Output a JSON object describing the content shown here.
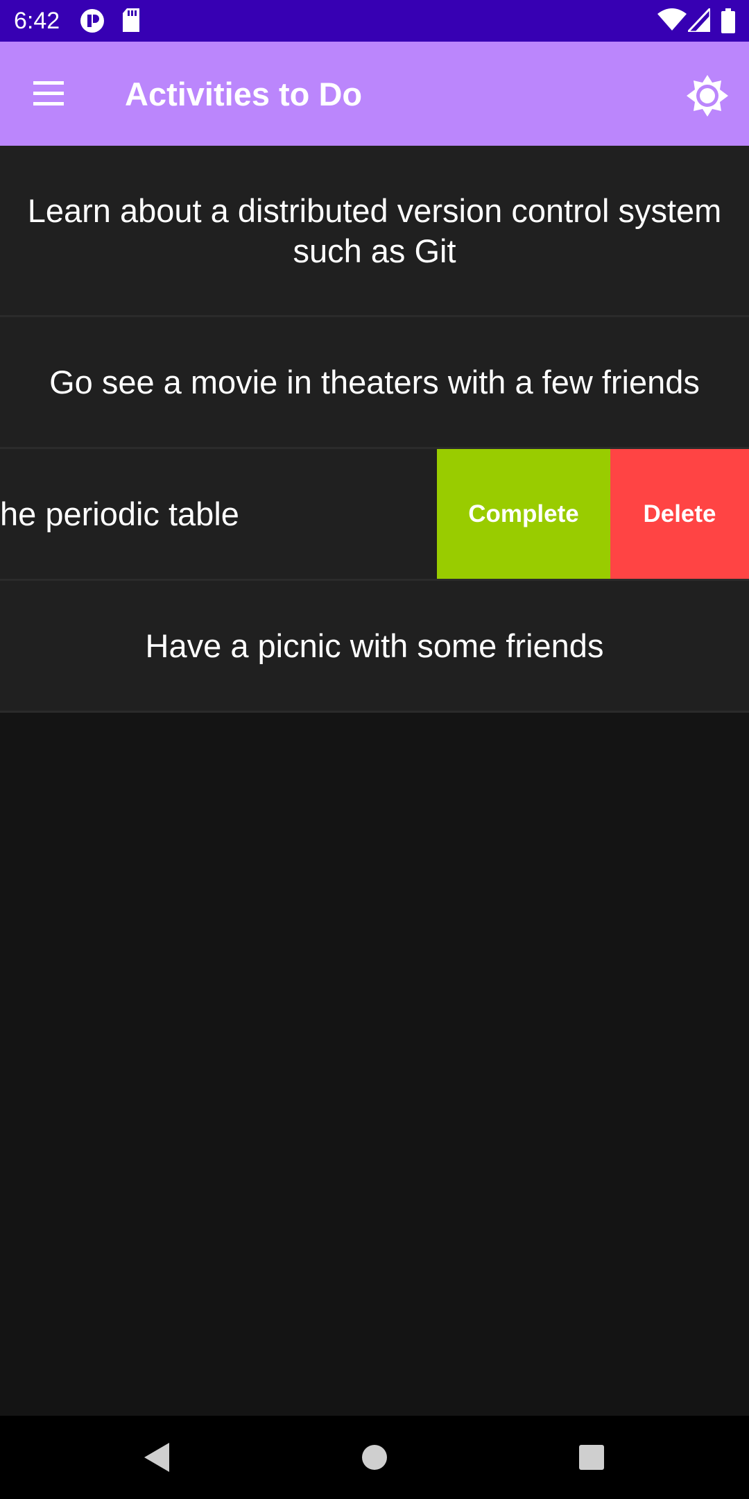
{
  "status_bar": {
    "time": "6:42",
    "icons_left": [
      "app-notification-icon",
      "sd-card-icon"
    ],
    "icons_right": [
      "wifi-icon",
      "signal-icon",
      "battery-icon"
    ]
  },
  "app_bar": {
    "title": "Activities to Do",
    "menu_icon": "hamburger-menu-icon",
    "settings_icon": "brightness-icon"
  },
  "activities": [
    {
      "text": "Learn about a distributed version control system such as Git"
    },
    {
      "text": "Go see a movie in theaters with a few friends"
    },
    {
      "text": "Learn the periodic table",
      "visible_text": "he periodic table",
      "swiped": true
    },
    {
      "text": "Have a picnic with some friends"
    }
  ],
  "swipe_actions": {
    "complete_label": "Complete",
    "delete_label": "Delete",
    "complete_color": "#99cc00",
    "delete_color": "#ff4444"
  },
  "nav_bar": {
    "back_icon": "back-icon",
    "home_icon": "home-icon",
    "recents_icon": "recents-icon"
  },
  "colors": {
    "status_bar": "#3700b3",
    "app_bar": "#bb86fc",
    "row_background": "#202020",
    "screen_background": "#141414"
  }
}
